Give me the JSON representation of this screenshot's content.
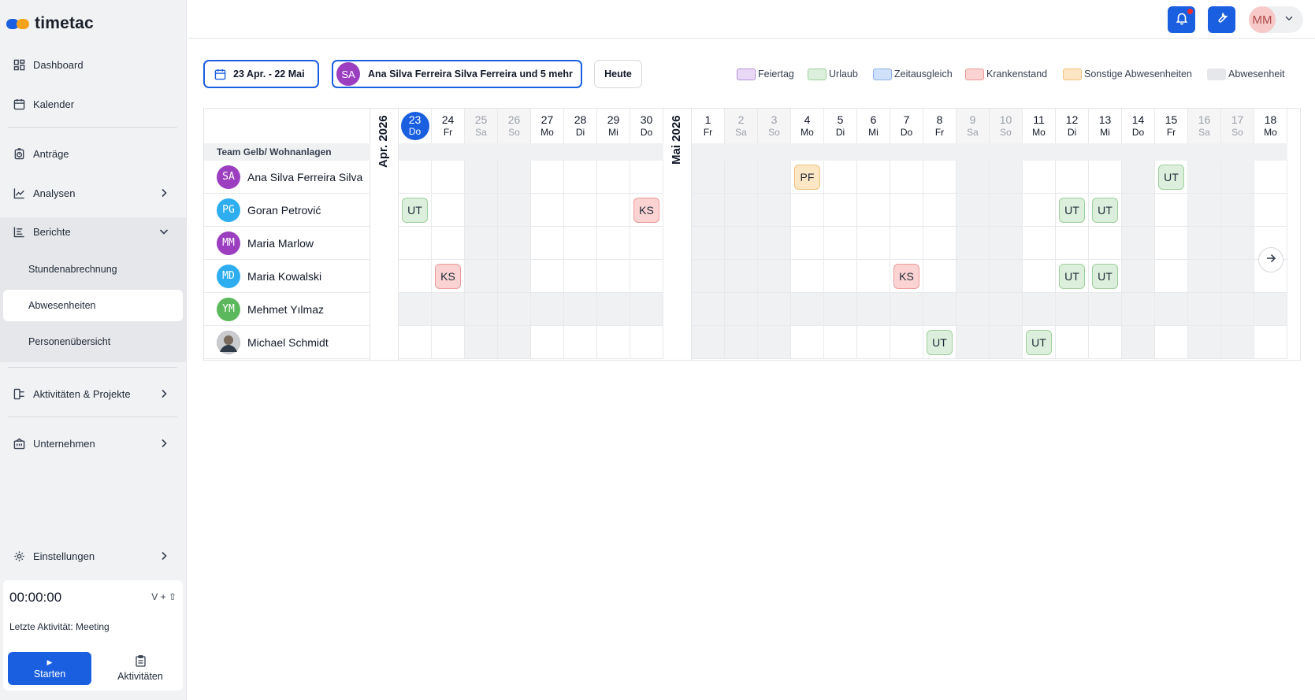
{
  "app": {
    "logo_text": "timetac"
  },
  "sidebar": {
    "items": [
      {
        "label": "Dashboard",
        "icon": "dashboard-icon"
      },
      {
        "label": "Kalender",
        "icon": "calendar-icon"
      },
      {
        "label": "Anträge",
        "icon": "requests-icon"
      },
      {
        "label": "Analysen",
        "icon": "chart-line-icon"
      },
      {
        "label": "Berichte",
        "icon": "report-icon"
      },
      {
        "label": "Aktivitäten & Projekte",
        "icon": "projects-icon"
      },
      {
        "label": "Unternehmen",
        "icon": "building-icon"
      },
      {
        "label": "Einstellungen",
        "icon": "gear-icon"
      }
    ],
    "berichte_sub": [
      {
        "label": "Stundenabrechnung"
      },
      {
        "label": "Abwesenheiten"
      },
      {
        "label": "Personenübersicht"
      }
    ],
    "timer": {
      "value": "00:00:00",
      "shortcut": "V + ⇧",
      "last_activity": "Letzte Aktivität: Meeting",
      "start_label": "Starten",
      "activities_label": "Aktivitäten"
    }
  },
  "topbar": {
    "user_initials": "MM"
  },
  "toolbar": {
    "date_range": "23 Apr. - 22 Mai",
    "people_initials": "SA",
    "people_label": "Ana Silva Ferreira Silva Ferreira und 5 mehr",
    "today_label": "Heute"
  },
  "legend": [
    {
      "label": "Feiertag",
      "color": "#e9d8f6",
      "border": "#b892db"
    },
    {
      "label": "Urlaub",
      "color": "#dcefdc",
      "border": "#9ccf9c"
    },
    {
      "label": "Zeitausgleich",
      "color": "#cfe0fa",
      "border": "#8fb2ea"
    },
    {
      "label": "Krankenstand",
      "color": "#fbd3d3",
      "border": "#ec9a9a"
    },
    {
      "label": "Sonstige Abwesenheiten",
      "color": "#fde6c4",
      "border": "#f0c07a"
    },
    {
      "label": "Abwesenheit",
      "color": "#e6e7ea",
      "border": "#e6e7ea"
    }
  ],
  "calendar": {
    "team": "Team Gelb/ Wohnanlagen",
    "months": [
      {
        "label": "Apr. 2026"
      },
      {
        "label": "Mai 2026"
      }
    ],
    "april_days": [
      {
        "d": "23",
        "n": "Do",
        "today": true
      },
      {
        "d": "24",
        "n": "Fr"
      },
      {
        "d": "25",
        "n": "Sa",
        "we": true
      },
      {
        "d": "26",
        "n": "So",
        "we": true
      },
      {
        "d": "27",
        "n": "Mo"
      },
      {
        "d": "28",
        "n": "Di"
      },
      {
        "d": "29",
        "n": "Mi"
      },
      {
        "d": "30",
        "n": "Do"
      }
    ],
    "may_days": [
      {
        "d": "1",
        "n": "Fr",
        "holiday": true
      },
      {
        "d": "2",
        "n": "Sa",
        "we": true
      },
      {
        "d": "3",
        "n": "So",
        "we": true
      },
      {
        "d": "4",
        "n": "Mo"
      },
      {
        "d": "5",
        "n": "Di"
      },
      {
        "d": "6",
        "n": "Mi"
      },
      {
        "d": "7",
        "n": "Do"
      },
      {
        "d": "8",
        "n": "Fr"
      },
      {
        "d": "9",
        "n": "Sa",
        "we": true
      },
      {
        "d": "10",
        "n": "So",
        "we": true
      },
      {
        "d": "11",
        "n": "Mo"
      },
      {
        "d": "12",
        "n": "Di"
      },
      {
        "d": "13",
        "n": "Mi"
      },
      {
        "d": "14",
        "n": "Do",
        "holiday": true
      },
      {
        "d": "15",
        "n": "Fr"
      },
      {
        "d": "16",
        "n": "Sa",
        "we": true
      },
      {
        "d": "17",
        "n": "So",
        "we": true
      },
      {
        "d": "18",
        "n": "Mo"
      }
    ],
    "people": [
      {
        "name": "Ana Silva Ferreira Silva",
        "initials": "SA",
        "color": "#9b3fc0",
        "absences": {
          "4": "PF",
          "15": "UT"
        }
      },
      {
        "name": "Goran Petrović",
        "initials": "PG",
        "color": "#2eaef0",
        "absences": {
          "a23": "UT",
          "a30": "KS",
          "12": "UT",
          "13": "UT"
        }
      },
      {
        "name": "Maria Marlow",
        "initials": "MM",
        "color": "#9b3fc0",
        "absences": {}
      },
      {
        "name": "Maria Kowalski",
        "initials": "MD",
        "color": "#2eaef0",
        "absences": {
          "a24": "KS",
          "7": "KS",
          "12": "UT",
          "13": "UT"
        }
      },
      {
        "name": "Mehmet Yılmaz",
        "initials": "YM",
        "color": "#5cb85c",
        "absences": {},
        "all_grey": true
      },
      {
        "name": "Michael Schmidt",
        "initials": "",
        "color": "#6b6b6b",
        "photo": true,
        "absences": {
          "8": "UT",
          "11": "UT"
        }
      }
    ]
  }
}
